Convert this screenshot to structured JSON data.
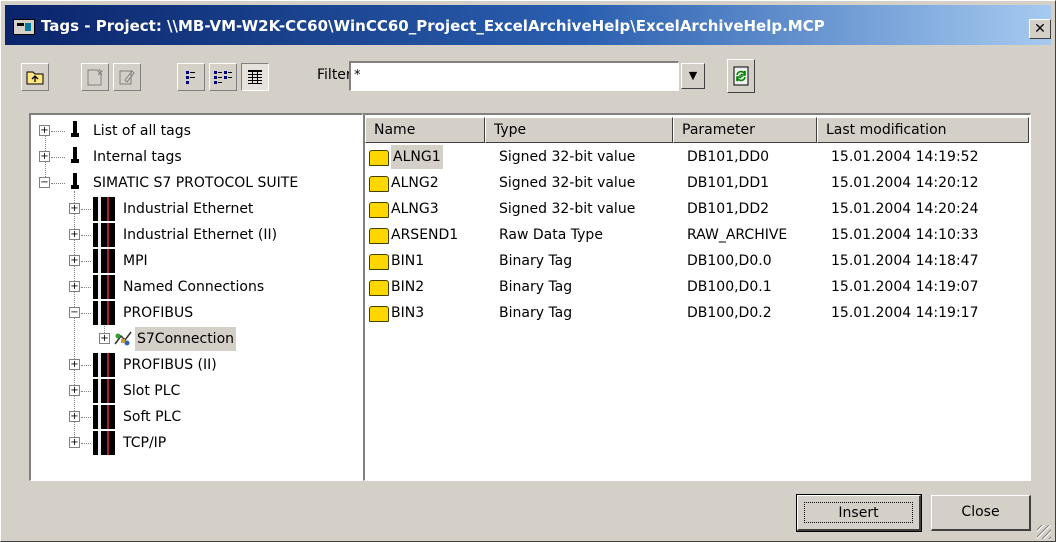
{
  "window": {
    "title": "Tags - Project: \\\\MB-VM-W2K-CC60\\WinCC60_Project_ExcelArchiveHelp\\ExcelArchiveHelp.MCP",
    "close_glyph": "✕"
  },
  "toolbar": {
    "filter_label": "Filter:",
    "filter_value": "*"
  },
  "tree": {
    "items": [
      {
        "label": "List of all tags",
        "icon": "tag-list-icon",
        "expander": "+"
      },
      {
        "label": "Internal tags",
        "icon": "tag-list-icon",
        "expander": "+"
      },
      {
        "label": "SIMATIC S7 PROTOCOL SUITE",
        "icon": "tag-list-icon",
        "expander": "−"
      },
      {
        "label": "Industrial Ethernet",
        "icon": "channel-unit-icon",
        "expander": "+"
      },
      {
        "label": "Industrial Ethernet (II)",
        "icon": "channel-unit-icon",
        "expander": "+"
      },
      {
        "label": "MPI",
        "icon": "channel-unit-icon",
        "expander": "+"
      },
      {
        "label": "Named Connections",
        "icon": "channel-unit-icon",
        "expander": "+"
      },
      {
        "label": "PROFIBUS",
        "icon": "channel-unit-icon",
        "expander": "−"
      },
      {
        "label": "S7Connection",
        "icon": "connection-icon",
        "expander": "+"
      },
      {
        "label": "PROFIBUS (II)",
        "icon": "channel-unit-icon",
        "expander": "+"
      },
      {
        "label": "Slot PLC",
        "icon": "channel-unit-icon",
        "expander": "+"
      },
      {
        "label": "Soft PLC",
        "icon": "channel-unit-icon",
        "expander": "+"
      },
      {
        "label": "TCP/IP",
        "icon": "channel-unit-icon",
        "expander": "+"
      }
    ]
  },
  "list": {
    "columns": [
      "Name",
      "Type",
      "Parameter",
      "Last modification"
    ],
    "rows": [
      {
        "name": "ALNG1",
        "type": "Signed 32-bit value",
        "parameter": "DB101,DD0",
        "modified": "15.01.2004 14:19:52"
      },
      {
        "name": "ALNG2",
        "type": "Signed 32-bit value",
        "parameter": "DB101,DD1",
        "modified": "15.01.2004 14:20:12"
      },
      {
        "name": "ALNG3",
        "type": "Signed 32-bit value",
        "parameter": "DB101,DD2",
        "modified": "15.01.2004 14:20:24"
      },
      {
        "name": "ARSEND1",
        "type": "Raw Data Type",
        "parameter": "RAW_ARCHIVE",
        "modified": "15.01.2004 14:10:33"
      },
      {
        "name": "BIN1",
        "type": "Binary Tag",
        "parameter": "DB100,D0.0",
        "modified": "15.01.2004 14:18:47"
      },
      {
        "name": "BIN2",
        "type": "Binary Tag",
        "parameter": "DB100,D0.1",
        "modified": "15.01.2004 14:19:07"
      },
      {
        "name": "BIN3",
        "type": "Binary Tag",
        "parameter": "DB100,D0.2",
        "modified": "15.01.2004 14:19:17"
      }
    ]
  },
  "buttons": {
    "insert": "Insert",
    "close": "Close"
  }
}
